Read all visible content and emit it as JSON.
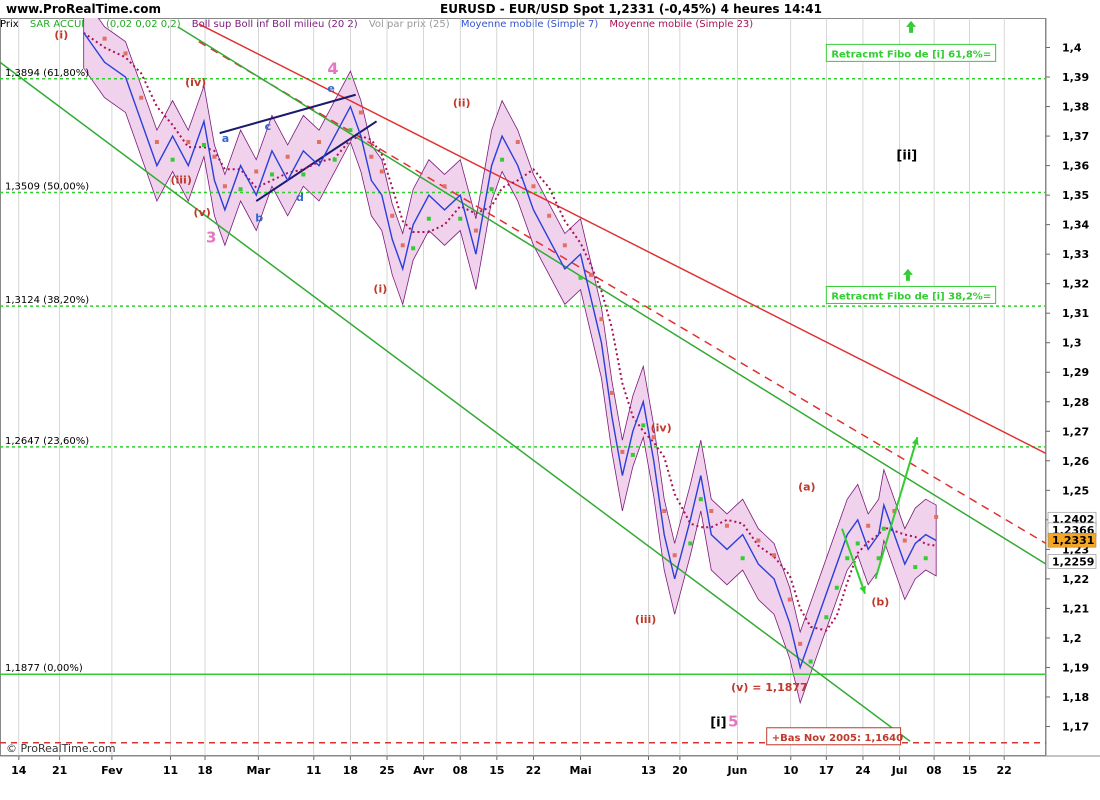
{
  "header": {
    "site": "www.ProRealTime.com",
    "title": "EURUSD - EUR/USD Spot     1,2331 (-0,45%)     4 heures  14:41"
  },
  "legend": [
    {
      "label": "Prix",
      "color": "#000000"
    },
    {
      "label": "SAR ACCUMUL (0,02 0,02 0,2)",
      "color": "#22aa22"
    },
    {
      "label": "Boll sup Boll inf Boll milieu (20 2)",
      "color": "#7a1a7a"
    },
    {
      "label": "Vol par prix (25)",
      "color": "#999999"
    },
    {
      "label": "Moyenne mobile (Simple 7)",
      "color": "#3355cc"
    },
    {
      "label": "Moyenne mobile (Simple 23)",
      "color": "#aa1155"
    }
  ],
  "watermark": "© ProRealTime.com",
  "colors": {
    "price": "#2a3fd8",
    "boll_fill": "#f0d2ec",
    "boll_line": "#7a1a7a",
    "sar_up": "#33cc33",
    "sar_down": "#e07060",
    "ma23": "#aa1155",
    "fibo": "#33cc33",
    "channel_red": "#e03030",
    "channel_green": "#33aa33",
    "grid": "#bbbbbb",
    "label_red": "#c0392b",
    "label_pink": "#e377c2",
    "label_blue": "#3366cc"
  },
  "chart_data": {
    "type": "line",
    "ylim": [
      1.16,
      1.41
    ],
    "y_ticks": [
      "1,17",
      "1,18",
      "1,19",
      "1,2",
      "1,21",
      "1,22",
      "1,23",
      "1,24",
      "1,25",
      "1,26",
      "1,27",
      "1,28",
      "1,29",
      "1,3",
      "1,31",
      "1,32",
      "1,33",
      "1,34",
      "1,35",
      "1,36",
      "1,37",
      "1,38",
      "1,39",
      "1,4"
    ],
    "x_ticks": [
      {
        "label": "14",
        "pos": 0.018
      },
      {
        "label": "21",
        "pos": 0.057
      },
      {
        "label": "Fev",
        "pos": 0.107
      },
      {
        "label": "11",
        "pos": 0.163
      },
      {
        "label": "18",
        "pos": 0.196
      },
      {
        "label": "Mar",
        "pos": 0.247
      },
      {
        "label": "11",
        "pos": 0.3
      },
      {
        "label": "18",
        "pos": 0.335
      },
      {
        "label": "25",
        "pos": 0.37
      },
      {
        "label": "Avr",
        "pos": 0.405
      },
      {
        "label": "08",
        "pos": 0.44
      },
      {
        "label": "15",
        "pos": 0.475
      },
      {
        "label": "22",
        "pos": 0.51
      },
      {
        "label": "Mai",
        "pos": 0.555
      },
      {
        "label": "13",
        "pos": 0.62
      },
      {
        "label": "20",
        "pos": 0.65
      },
      {
        "label": "Jun",
        "pos": 0.705
      },
      {
        "label": "10",
        "pos": 0.756
      },
      {
        "label": "17",
        "pos": 0.79
      },
      {
        "label": "24",
        "pos": 0.825
      },
      {
        "label": "Jul",
        "pos": 0.86
      },
      {
        "label": "08",
        "pos": 0.893
      },
      {
        "label": "15",
        "pos": 0.927
      },
      {
        "label": "22",
        "pos": 0.96
      }
    ],
    "price_series": {
      "name": "EURUSD",
      "points": [
        [
          0.08,
          1.405
        ],
        [
          0.1,
          1.395
        ],
        [
          0.12,
          1.39
        ],
        [
          0.135,
          1.375
        ],
        [
          0.15,
          1.36
        ],
        [
          0.165,
          1.37
        ],
        [
          0.18,
          1.36
        ],
        [
          0.195,
          1.375
        ],
        [
          0.205,
          1.355
        ],
        [
          0.215,
          1.345
        ],
        [
          0.23,
          1.36
        ],
        [
          0.245,
          1.35
        ],
        [
          0.26,
          1.365
        ],
        [
          0.275,
          1.355
        ],
        [
          0.29,
          1.365
        ],
        [
          0.305,
          1.36
        ],
        [
          0.32,
          1.37
        ],
        [
          0.335,
          1.38
        ],
        [
          0.345,
          1.37
        ],
        [
          0.355,
          1.355
        ],
        [
          0.365,
          1.35
        ],
        [
          0.375,
          1.335
        ],
        [
          0.385,
          1.325
        ],
        [
          0.395,
          1.34
        ],
        [
          0.41,
          1.35
        ],
        [
          0.425,
          1.345
        ],
        [
          0.44,
          1.35
        ],
        [
          0.455,
          1.33
        ],
        [
          0.47,
          1.36
        ],
        [
          0.48,
          1.37
        ],
        [
          0.495,
          1.36
        ],
        [
          0.51,
          1.345
        ],
        [
          0.525,
          1.335
        ],
        [
          0.54,
          1.325
        ],
        [
          0.555,
          1.33
        ],
        [
          0.565,
          1.315
        ],
        [
          0.575,
          1.3
        ],
        [
          0.585,
          1.275
        ],
        [
          0.595,
          1.255
        ],
        [
          0.605,
          1.27
        ],
        [
          0.615,
          1.28
        ],
        [
          0.625,
          1.26
        ],
        [
          0.635,
          1.235
        ],
        [
          0.645,
          1.22
        ],
        [
          0.66,
          1.24
        ],
        [
          0.67,
          1.255
        ],
        [
          0.68,
          1.235
        ],
        [
          0.695,
          1.23
        ],
        [
          0.71,
          1.235
        ],
        [
          0.725,
          1.225
        ],
        [
          0.74,
          1.22
        ],
        [
          0.755,
          1.205
        ],
        [
          0.765,
          1.19
        ],
        [
          0.775,
          1.2
        ],
        [
          0.79,
          1.215
        ],
        [
          0.8,
          1.225
        ],
        [
          0.81,
          1.235
        ],
        [
          0.82,
          1.24
        ],
        [
          0.83,
          1.23
        ],
        [
          0.84,
          1.235
        ],
        [
          0.845,
          1.245
        ],
        [
          0.855,
          1.235
        ],
        [
          0.865,
          1.225
        ],
        [
          0.875,
          1.232
        ],
        [
          0.885,
          1.235
        ],
        [
          0.895,
          1.233
        ]
      ]
    },
    "fibo_levels": [
      {
        "label": "1,3894 (61,80%)",
        "value": 1.3894
      },
      {
        "label": "1,3509 (50,00%)",
        "value": 1.3509
      },
      {
        "label": "1,3124 (38,20%)",
        "value": 1.3124
      },
      {
        "label": "1,2647 (23,60%)",
        "value": 1.2647
      },
      {
        "label": "1,1877 (0,00%)",
        "value": 1.1877
      }
    ],
    "bas_line": {
      "value": 1.1645,
      "label": "+Bas Nov 2005: 1,1640"
    },
    "channels": {
      "red": [
        {
          "p1": [
            0.19,
            1.408
          ],
          "p2": [
            1.0,
            1.2625
          ]
        },
        {
          "p1": [
            0.19,
            1.402
          ],
          "p2": [
            1.0,
            1.232
          ],
          "dashed": true
        }
      ],
      "green": [
        {
          "p1": [
            0.17,
            1.407
          ],
          "p2": [
            1.0,
            1.225
          ]
        },
        {
          "p1": [
            0.0,
            1.395
          ],
          "p2": [
            0.87,
            1.165
          ]
        }
      ],
      "wedge": [
        {
          "p1": [
            0.21,
            1.371
          ],
          "p2": [
            0.34,
            1.384
          ]
        },
        {
          "p1": [
            0.245,
            1.348
          ],
          "p2": [
            0.36,
            1.375
          ]
        }
      ]
    },
    "price_labels": [
      {
        "text": "1,2402",
        "value": 1.2402,
        "style": "white"
      },
      {
        "text": "1,2366",
        "value": 1.2366,
        "style": "white"
      },
      {
        "text": "1,2331",
        "value": 1.2331,
        "style": "orange"
      },
      {
        "text": "1,2259",
        "value": 1.2259,
        "style": "white"
      }
    ],
    "annotations": [
      {
        "text": "(i)",
        "x": 0.052,
        "y": 1.403,
        "color": "red"
      },
      {
        "text": "(iv)",
        "x": 0.177,
        "y": 1.387,
        "color": "red"
      },
      {
        "text": "(iii)",
        "x": 0.163,
        "y": 1.354,
        "color": "red"
      },
      {
        "text": "(v)",
        "x": 0.185,
        "y": 1.343,
        "color": "red"
      },
      {
        "text": "3",
        "x": 0.197,
        "y": 1.334,
        "color": "pink",
        "size": 15
      },
      {
        "text": "4",
        "x": 0.313,
        "y": 1.391,
        "color": "pink",
        "size": 16
      },
      {
        "text": "e",
        "x": 0.313,
        "y": 1.385,
        "color": "blue"
      },
      {
        "text": "c",
        "x": 0.253,
        "y": 1.372,
        "color": "blue"
      },
      {
        "text": "a",
        "x": 0.212,
        "y": 1.368,
        "color": "blue"
      },
      {
        "text": "b",
        "x": 0.244,
        "y": 1.341,
        "color": "blue"
      },
      {
        "text": "d",
        "x": 0.283,
        "y": 1.348,
        "color": "blue"
      },
      {
        "text": "(ii)",
        "x": 0.433,
        "y": 1.38,
        "color": "red"
      },
      {
        "text": "(i)",
        "x": 0.357,
        "y": 1.317,
        "color": "red"
      },
      {
        "text": "(iv)",
        "x": 0.622,
        "y": 1.27,
        "color": "red"
      },
      {
        "text": "(iii)",
        "x": 0.607,
        "y": 1.205,
        "color": "red"
      },
      {
        "text": "(a)",
        "x": 0.763,
        "y": 1.25,
        "color": "red"
      },
      {
        "text": "(b)",
        "x": 0.833,
        "y": 1.211,
        "color": "red"
      },
      {
        "text": "(v) = 1,1877",
        "x": 0.699,
        "y": 1.182,
        "color": "red"
      },
      {
        "text": "[i]",
        "x": 0.679,
        "y": 1.17,
        "color": "black",
        "size": 13
      },
      {
        "text": "5",
        "x": 0.696,
        "y": 1.17,
        "color": "pink",
        "size": 15
      },
      {
        "text": "[ii]",
        "x": 0.857,
        "y": 1.362,
        "color": "black",
        "size": 13
      }
    ],
    "boxes": [
      {
        "text": "Retracmt Fibo de [i] 61,8%=",
        "x": 0.79,
        "y": 1.397,
        "color": "green"
      },
      {
        "text": "Retracmt Fibo de [i] 38,2%=",
        "x": 0.79,
        "y": 1.315,
        "color": "green"
      },
      {
        "text": "+Bas Nov 2005: 1,1640",
        "x": 0.733,
        "y": 1.1655,
        "color": "red"
      }
    ],
    "forecast_arrows": [
      {
        "from": [
          0.805,
          1.237
        ],
        "to": [
          0.827,
          1.215
        ]
      },
      {
        "from": [
          0.837,
          1.22
        ],
        "to": [
          0.877,
          1.268
        ]
      }
    ],
    "small_arrows": [
      {
        "x": 0.868,
        "y": 1.323,
        "dir": "up"
      },
      {
        "x": 0.871,
        "y": 1.407,
        "dir": "up"
      }
    ]
  }
}
